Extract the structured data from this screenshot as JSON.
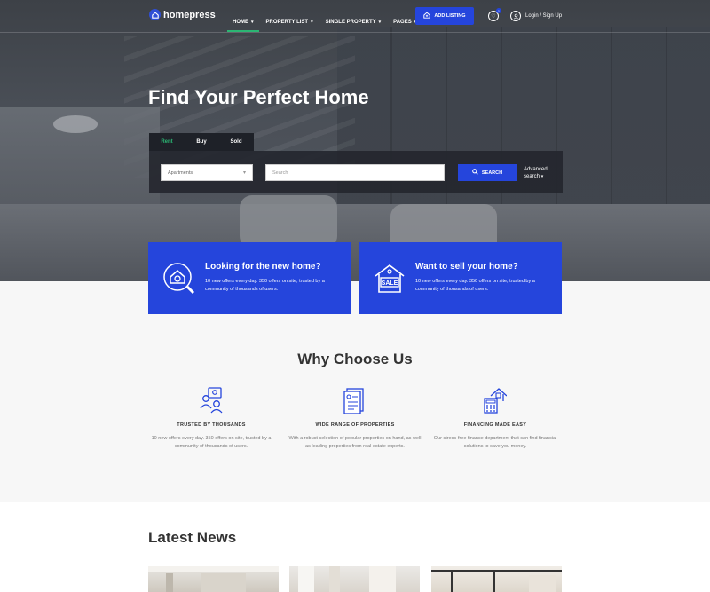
{
  "header": {
    "logo_text": "homepress",
    "nav": [
      {
        "label": "HOME",
        "active": true
      },
      {
        "label": "PROPERTY LIST",
        "active": false
      },
      {
        "label": "SINGLE PROPERTY",
        "active": false
      },
      {
        "label": "PAGES",
        "active": false
      }
    ],
    "add_listing_label": "ADD LISTING",
    "favorites_count": "1",
    "login_label": "Login / Sign Up"
  },
  "hero": {
    "title": "Find Your Perfect Home",
    "tabs": [
      "Rent",
      "Buy",
      "Sold"
    ],
    "active_tab": "Rent",
    "property_type_value": "Apartments",
    "search_placeholder": "Search",
    "search_button_label": "SEARCH",
    "advanced_search_line1": "Advanced",
    "advanced_search_line2": "search"
  },
  "cards": [
    {
      "title": "Looking for the new home?",
      "text": "10 new offers every day. 350 offers on site, trusted by a community of thousands of users.",
      "icon": "house-search-icon"
    },
    {
      "title": "Want to sell your home?",
      "text": "10 new offers every day. 350 offers on site, trusted by a community of thousands of users.",
      "icon": "house-sale-icon"
    }
  ],
  "why": {
    "title": "Why Choose Us",
    "features": [
      {
        "title": "TRUSTED BY THOUSANDS",
        "text": "10 new offers every day. 350 offers on site, trusted by a community of thousands of users.",
        "icon": "users-icon"
      },
      {
        "title": "WIDE RANGE OF PROPERTIES",
        "text": "With a robust selection of popular properties on hand, as well as leading properties from real estate experts.",
        "icon": "document-icon"
      },
      {
        "title": "FINANCING MADE EASY",
        "text": "Our stress-free finance department that can find financial solutions to save you money.",
        "icon": "calculator-house-icon"
      }
    ]
  },
  "news": {
    "title": "Latest News"
  },
  "colors": {
    "accent_blue": "#2545dc",
    "accent_green": "#2bb673"
  }
}
